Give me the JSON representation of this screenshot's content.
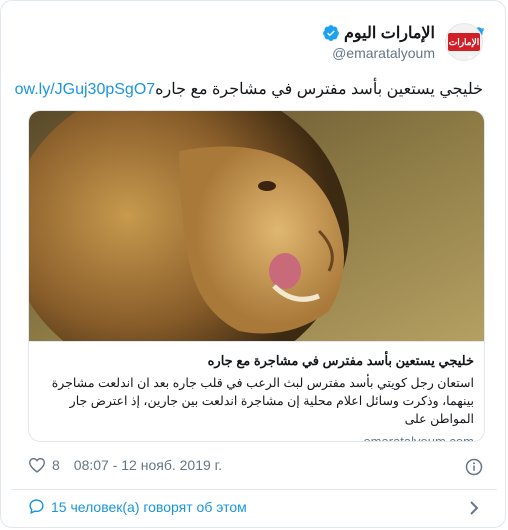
{
  "author": {
    "display_name": "الإمارات اليوم",
    "handle": "@emaratalyoum",
    "avatar_text": "الإمارات اليوم"
  },
  "tweet": {
    "text": "خليجي يستعين بأسد مفترس  في مشاجرة مع جاره",
    "link": "ow.ly/JGuj30pSgO7"
  },
  "card": {
    "title": "خليجي يستعين بأسد مفترس في مشاجرة مع جاره",
    "description": "استعان رجل كويتي بأسد مفترس لبث الرعب في قلب جاره بعد ان اندلعت مشاجرة بينهما، وذكرت وسائل اعلام محلية إن مشاجرة اندلعت بين جارين، إذ اعترض جار المواطن على",
    "domain": "emaratalyoum.com"
  },
  "meta": {
    "likes": "8",
    "timestamp": "08:07 - 12 нояб. 2019 г."
  },
  "footer": {
    "talking": "15 человек(а) говорят об этом"
  },
  "colors": {
    "twitter_blue": "#1da1f2",
    "link_blue": "#1b95e0",
    "secondary_text": "#657786",
    "border": "#e1e8ed"
  },
  "icons": [
    "twitter-bird-icon",
    "verified-icon",
    "heart-icon",
    "info-icon",
    "chat-icon",
    "chevron-right-icon"
  ]
}
